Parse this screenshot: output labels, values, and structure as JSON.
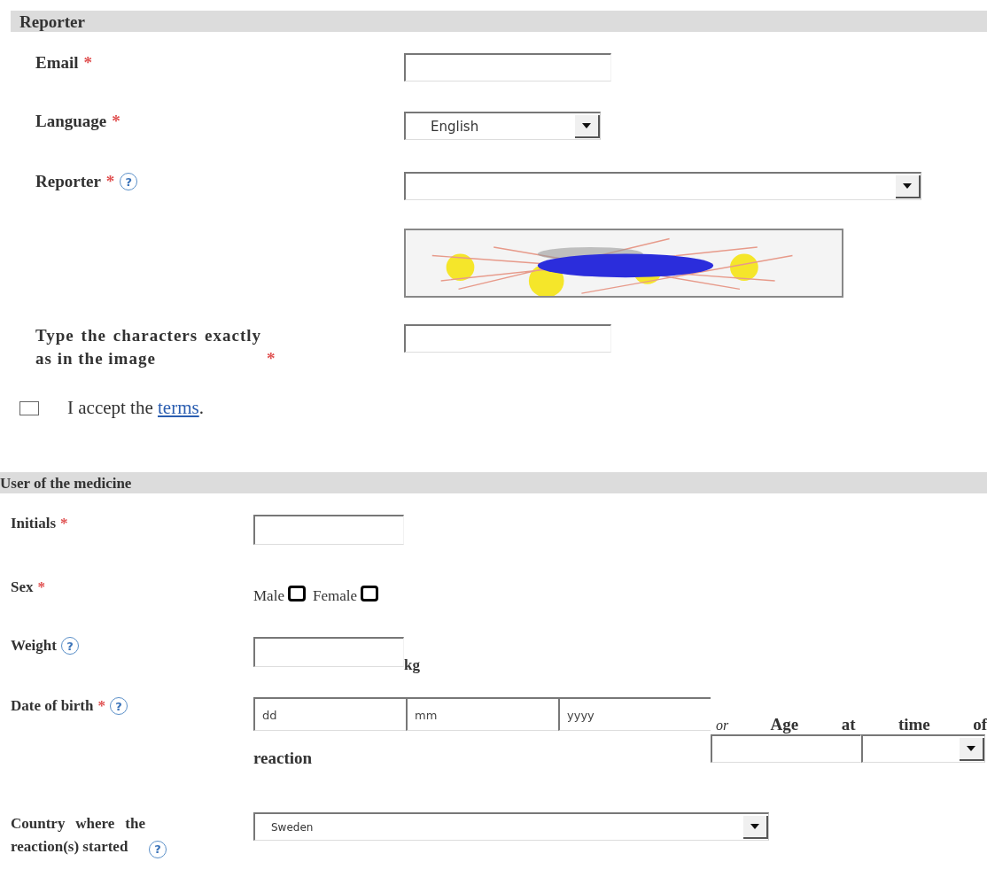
{
  "reporter": {
    "title": "Reporter",
    "email": {
      "label": "Email",
      "mark": "*"
    },
    "language": {
      "label": "Language",
      "mark": "*",
      "value": "English"
    },
    "reporter": {
      "label": "Reporter",
      "mark": "*",
      "help": "?"
    },
    "captcha_input": {
      "label": "Type the characters exactly as in the image",
      "mark": "*"
    },
    "terms": {
      "checked": false,
      "text": "I accept the ",
      "link": "terms",
      "after": "."
    }
  },
  "user": {
    "title": "User of the medicine",
    "initials": {
      "label": "Initials",
      "mark": "*"
    },
    "sex": {
      "label": "Sex",
      "mark": "*",
      "options": [
        {
          "label": "Male",
          "selected": false
        },
        {
          "label": "Female",
          "selected": false
        }
      ]
    },
    "weight": {
      "label": "Weight",
      "help": "?",
      "unit": "kg"
    },
    "dob": {
      "label": "Date of birth",
      "mark": "*",
      "help": "?",
      "placeholders": [
        "dd",
        "mm",
        "yyyy"
      ],
      "or": "or",
      "age_text": "Age at time of",
      "age_text_end": "reaction"
    },
    "country": {
      "label": "Country where the reaction(s) started",
      "help": "?",
      "value": "Sweden"
    }
  }
}
